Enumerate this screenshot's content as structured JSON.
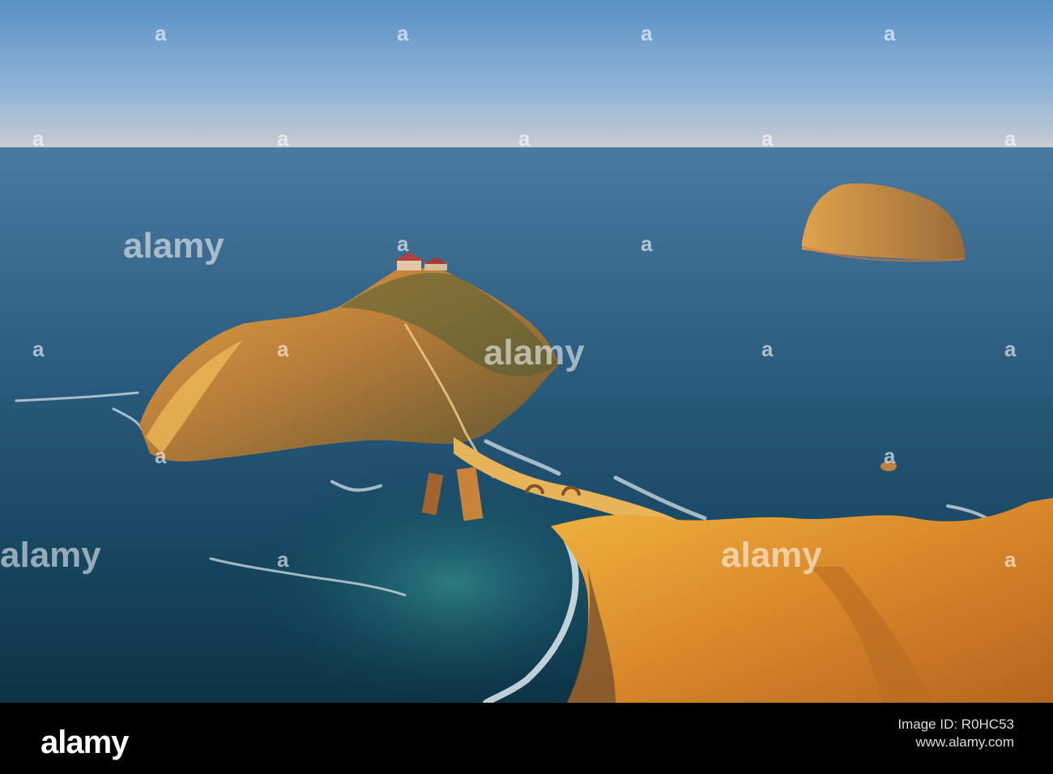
{
  "watermark": {
    "text": "alamy",
    "marks": [
      "a",
      "a",
      "a",
      "a",
      "a",
      "a",
      "a",
      "a",
      "a",
      "a",
      "a",
      "a",
      "a",
      "a",
      "a",
      "a",
      "a",
      "a",
      "a"
    ]
  },
  "footer": {
    "logo_text": "alamy",
    "image_id_label": "Image ID: R0HC53",
    "url": "www.alamy.com",
    "image_id": ""
  },
  "colors": {
    "sky_top": "#5e93c6",
    "sky_horizon": "#c7c9cf",
    "sea_far": "#3f6f96",
    "sea_near": "#0f3a4e",
    "cliff_lit": "#e6a233",
    "cliff_shadow": "#5b4d2a",
    "footer_bg": "#000000"
  }
}
